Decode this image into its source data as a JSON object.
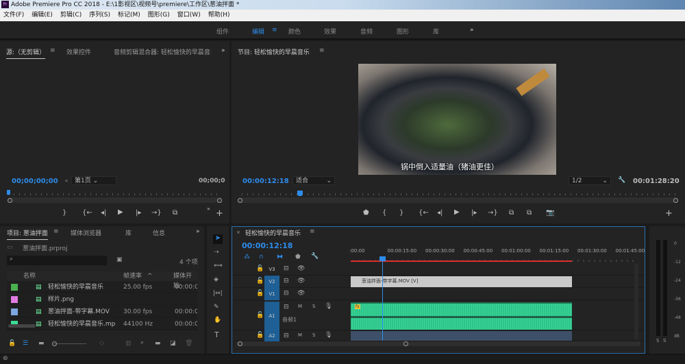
{
  "window": {
    "title": "Adobe Premiere Pro CC 2018 - E:\\1影视区\\视频号\\premiere\\工作区\\葱油拌面 *",
    "logo": "Pr"
  },
  "menu": [
    "文件(F)",
    "编辑(E)",
    "剪辑(C)",
    "序列(S)",
    "标记(M)",
    "图形(G)",
    "窗口(W)",
    "帮助(H)"
  ],
  "workspaces": [
    {
      "label": "组件"
    },
    {
      "label": "编辑",
      "active": true
    },
    {
      "label": "颜色"
    },
    {
      "label": "效果"
    },
    {
      "label": "音频"
    },
    {
      "label": "图形"
    },
    {
      "label": "库"
    }
  ],
  "workspace_more": "»",
  "source": {
    "tabs": [
      "源:（无剪辑）",
      "效果控件",
      "音频剪辑混合器: 轻松愉快的早晨音乐"
    ],
    "more": "»",
    "timecode": "00;00;00;00",
    "page": "第1页",
    "end_timecode": "00;00;0"
  },
  "program": {
    "title": "节目: 轻松愉快的早晨音乐",
    "timecode": "00:00:12:18",
    "fit": "适合",
    "resolution": "1/2",
    "duration": "00:01:28:20",
    "subtitle": "锅中倒入适量油（猪油更佳）",
    "playhead_fraction": 0.14
  },
  "project": {
    "tabs": [
      "项目: 葱油拌面",
      "媒体浏览器",
      "库",
      "信息"
    ],
    "more": "»",
    "file": "葱油拌面.prproj",
    "search_placeholder": "",
    "count": "4 个项",
    "columns": [
      "名称",
      "帧速率",
      "媒体开始"
    ],
    "items": [
      {
        "name": "轻松愉快的早晨音乐",
        "rate": "25.00 fps",
        "start": "00:00:0",
        "color": "#4caf50",
        "icon": "sequence-icon"
      },
      {
        "name": "样片.png",
        "rate": "",
        "start": "",
        "color": "#e07be0",
        "icon": "image-icon"
      },
      {
        "name": "葱油拌面-带字幕.MOV",
        "rate": "30.00 fps",
        "start": "00:00:0",
        "color": "#7ea6e0",
        "icon": "video-icon"
      },
      {
        "name": "轻松愉快的早晨音乐.mp",
        "rate": "44100 Hz",
        "start": "00:00:0",
        "color": "#3ddc97",
        "icon": "audio-icon"
      }
    ]
  },
  "timeline": {
    "title": "轻松愉快的早晨音乐",
    "timecode": "00:00:12:18",
    "ruler": [
      ":00:00",
      "00:00:15:00",
      "00:00:30:00",
      "00:00:45:00",
      "00:01:00:00",
      "00:01:15:00",
      "00:01:30:00",
      "00:01:45:00"
    ],
    "tracks": [
      {
        "id": "V3"
      },
      {
        "id": "V2"
      },
      {
        "id": "V1"
      },
      {
        "id": "A1",
        "name": "音频1"
      },
      {
        "id": "A2"
      }
    ],
    "video_clip": "葱油拌面-带字幕.MOV [V]",
    "fx": "fx",
    "mute": "M",
    "solo": "S"
  },
  "meter": {
    "labels": [
      "0",
      "-12",
      "-24",
      "-36",
      "-48",
      "dB"
    ],
    "solo": "S",
    "solo2": "S"
  },
  "colors": {
    "accent": "#2d8ceb",
    "audio_clip": "#2fc389",
    "video_clip": "#c9c9c9"
  }
}
